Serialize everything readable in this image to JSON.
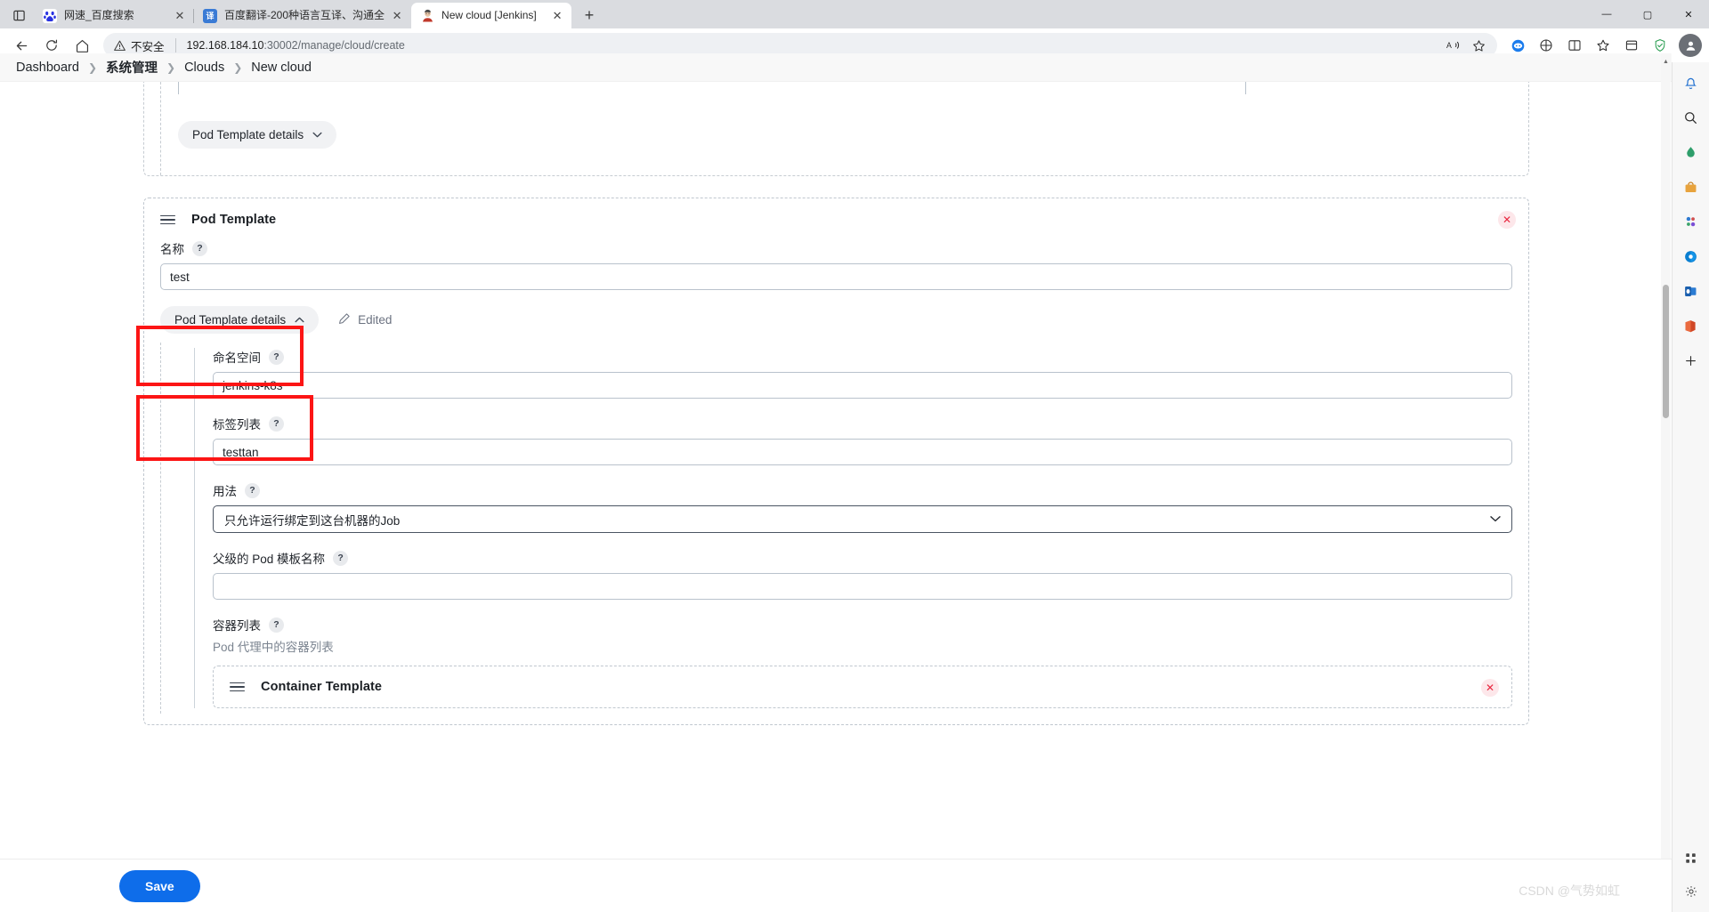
{
  "browser": {
    "tabs": [
      {
        "title": "网速_百度搜索",
        "favicon": "baidu-icon",
        "active": false
      },
      {
        "title": "百度翻译-200种语言互译、沟通全",
        "favicon": "fanyi-icon",
        "active": false
      },
      {
        "title": "New cloud [Jenkins]",
        "favicon": "jenkins-icon",
        "active": true
      }
    ],
    "new_tab_label": "+",
    "close_label": "✕",
    "window": {
      "minimize": "—",
      "maximize": "▢",
      "close": "✕"
    },
    "nav": {
      "back": "←",
      "reload": "⟳",
      "home": "⌂"
    },
    "omnibox": {
      "security_label": "不安全",
      "url_host": "192.168.184.10",
      "url_path": ":30002/manage/cloud/create",
      "read_aloud": "A",
      "favorite": "☆"
    },
    "toolbar_icons": [
      "collections-icon",
      "browser-essentials-icon",
      "split-screen-icon",
      "favorites-icon",
      "collections-bar-icon",
      "shield-icon"
    ],
    "profile_initial": "●"
  },
  "rail": {
    "items": [
      "copilot-icon",
      "search-icon",
      "shopping-icon",
      "tools-icon",
      "drop-icon",
      "games-icon",
      "outlook-icon",
      "office-icon",
      "add-icon"
    ],
    "bottom": [
      "apps-icon",
      "settings-icon"
    ]
  },
  "breadcrumb": {
    "items": [
      {
        "label": "Dashboard",
        "bold": false
      },
      {
        "label": "系统管理",
        "bold": true
      },
      {
        "label": "Clouds",
        "bold": false
      },
      {
        "label": "New cloud",
        "bold": false
      }
    ],
    "separator": "❯"
  },
  "main": {
    "previous_section": {
      "details_button": "Pod Template details",
      "details_chevron": "⌄"
    },
    "pod_template": {
      "title": "Pod Template",
      "delete_label": "✕",
      "name_field": {
        "label": "名称",
        "help": "?",
        "value": "test"
      },
      "details_button": "Pod Template details",
      "details_chevron": "⌃",
      "edited_label": "Edited",
      "namespace_field": {
        "label": "命名空间",
        "help": "?",
        "value": "jenkins-k8s"
      },
      "labels_field": {
        "label": "标签列表",
        "help": "?",
        "value": "testtan"
      },
      "usage_field": {
        "label": "用法",
        "help": "?",
        "value": "只允许运行绑定到这台机器的Job",
        "chevron": "⌄"
      },
      "parent_template_field": {
        "label": "父级的 Pod 模板名称",
        "help": "?",
        "value": ""
      },
      "containers_field": {
        "label": "容器列表",
        "help": "?",
        "description": "Pod 代理中的容器列表"
      },
      "container_template": {
        "title": "Container Template",
        "delete_label": "✕"
      }
    }
  },
  "footer": {
    "save_label": "Save",
    "watermark": "CSDN @气势如虹"
  },
  "colors": {
    "accent": "#0e6dea",
    "annotation": "#fc1515",
    "delete_badge_bg": "#fde7ea",
    "delete_badge_fg": "#e8273f"
  }
}
